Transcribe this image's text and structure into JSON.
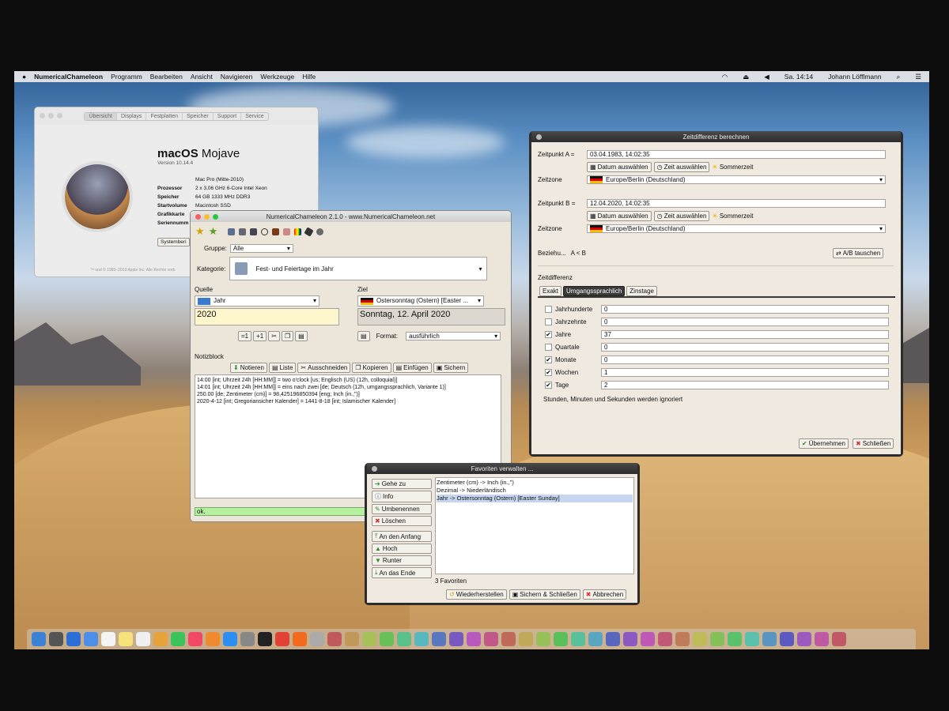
{
  "menubar": {
    "app": "NumericalChameleon",
    "items": [
      "Programm",
      "Bearbeiten",
      "Ansicht",
      "Navigieren",
      "Werkzeuge",
      "Hilfe"
    ],
    "clock": "Sa. 14:14",
    "user": "Johann Löfflmann"
  },
  "about": {
    "tabs": [
      "Übersicht",
      "Displays",
      "Festplatten",
      "Speicher",
      "Support",
      "Service"
    ],
    "os_name": "macOS",
    "os_sub": "Mojave",
    "version": "Version 10.14.4",
    "specs": [
      [
        "",
        "Mac Pro (Mitte-2010)"
      ],
      [
        "Prozessor",
        "2 x 3,06 GHz 6-Core Intel Xeon"
      ],
      [
        "Speicher",
        "64 GB 1333 MHz DDR3"
      ],
      [
        "Startvolume",
        "Macintosh SSD"
      ],
      [
        "Grafikkarte",
        ""
      ],
      [
        "Seriennumm",
        ""
      ]
    ],
    "button": "Systemberi",
    "footer": "™ und © 1983–2019 Apple Inc. Alle Rechte vorb"
  },
  "nc": {
    "title": "NumericalChameleon 2.1.0 - www.NumericalChameleon.net",
    "gruppe_label": "Gruppe:",
    "gruppe_value": "Alle",
    "kategorie_label": "Kategorie:",
    "kategorie_value": "Fest- und Feiertage im Jahr",
    "quelle_label": "Quelle",
    "quelle_unit": "Jahr",
    "quelle_value": "2020",
    "ziel_label": "Ziel",
    "ziel_unit": "Ostersonntag (Ostern) [Easter ...",
    "ziel_value": "Sonntag, 12. April 2020",
    "format_label": "Format:",
    "format_value": "ausführlich",
    "notiz_label": "Notizblock",
    "notiz_buttons": [
      "Notieren",
      "Liste",
      "Ausschneiden",
      "Kopieren",
      "Einfügen",
      "Sichern"
    ],
    "notes": [
      "14:00 [int; Uhrzeit 24h [HH:MM]] = two o'clock [us; Englisch (US) (12h, colloquial)]",
      "14:01 [int; Uhrzeit 24h [HH:MM]] = eins nach zwei [de; Deutsch (12h, umgangssprachlich, Variante 1)]",
      "250.00 [de; Zentimeter (cm)] = 98,425196850394 [eng; Inch (in.,\")]",
      "2020-4-12 [int; Gregoriansicher Kalender] = 1441-8-18 [int; Islamischer Kalender]"
    ],
    "status": "ok.",
    "mini_buttons": [
      "=1",
      "+1"
    ]
  },
  "zeit": {
    "title": "Zeitdifferenz berechnen",
    "a_label": "Zeitpunkt A =",
    "a_value": "03.04.1983, 14:02:35",
    "b_label": "Zeitpunkt B =",
    "b_value": "12.04.2020, 14:02:35",
    "datum_btn": "Datum auswählen",
    "zeit_btn": "Zeit auswählen",
    "sommer": "Sommerzeit",
    "zone_label": "Zeitzone",
    "zone_value": "Europe/Berlin (Deutschland)",
    "bez_label": "Beziehu...",
    "bez_value": "A < B",
    "tausch_btn": "A/B tauschen",
    "diff_label": "Zeitdifferenz",
    "tabs": [
      "Exakt",
      "Umgangssprachlich",
      "Zinstage"
    ],
    "rows": [
      {
        "label": "Jahrhunderte",
        "checked": false,
        "value": "0"
      },
      {
        "label": "Jahrzehnte",
        "checked": false,
        "value": "0"
      },
      {
        "label": "Jahre",
        "checked": true,
        "value": "37"
      },
      {
        "label": "Quartale",
        "checked": false,
        "value": "0"
      },
      {
        "label": "Monate",
        "checked": true,
        "value": "0"
      },
      {
        "label": "Wochen",
        "checked": true,
        "value": "1"
      },
      {
        "label": "Tage",
        "checked": true,
        "value": "2"
      }
    ],
    "note": "Stunden, Minuten und Sekunden werden ignoriert",
    "ok_btn": "Übernehmen",
    "close_btn": "Schließen"
  },
  "fav": {
    "title": "Favoriten verwalten ...",
    "buttons": [
      "Gehe zu",
      "Info",
      "Umbenennen",
      "Löschen"
    ],
    "buttons2": [
      "An den Anfang",
      "Hoch",
      "Runter",
      "An das Ende"
    ],
    "items": [
      "Zentimeter (cm) -> Inch (in.,\")",
      "Dezimal -> Niederländisch",
      "Jahr -> Ostersonntag (Ostern) [Easter Sunday]"
    ],
    "count": "3 Favoriten",
    "bottom": [
      "Wiederherstellen",
      "Sichern & Schließen",
      "Abbrechen"
    ]
  },
  "colors": {
    "accent": "#3b7bd6",
    "status_green": "#b6f1a0",
    "dark_title": "#2c2c2c"
  },
  "dock_icons": [
    "finder-icon",
    "launchpad-icon",
    "safari-icon",
    "mail-icon",
    "calendar-icon",
    "notes-icon",
    "reminders-icon",
    "photos-icon",
    "messages-icon",
    "music-icon",
    "books-icon",
    "app-store-icon",
    "preferences-icon",
    "terminal-icon",
    "chrome-icon",
    "firefox-icon",
    "trash-icon"
  ]
}
